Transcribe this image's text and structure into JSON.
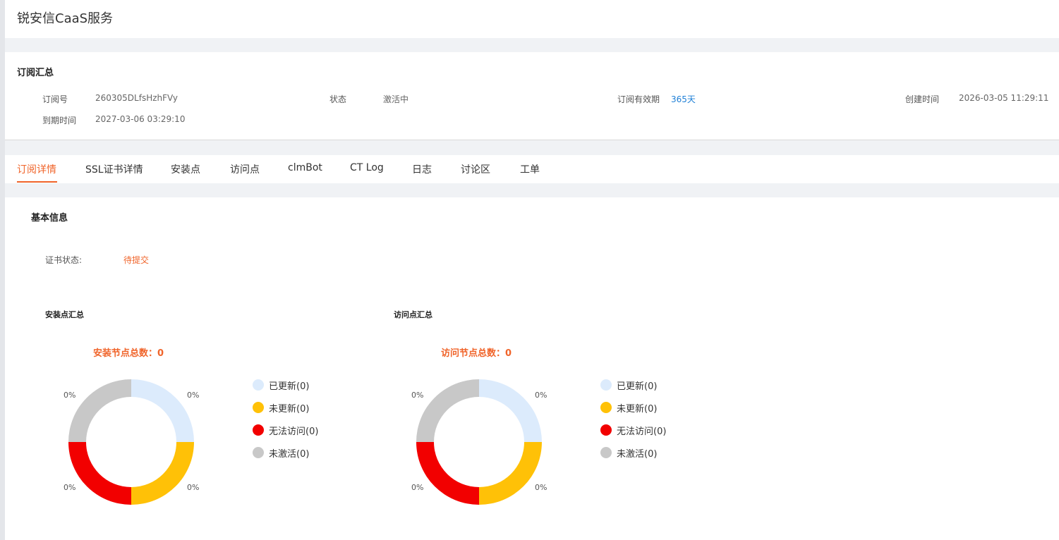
{
  "app": {
    "title": "锐安信CaaS服务"
  },
  "summary": {
    "title": "订阅汇总",
    "fields": [
      {
        "label": "订阅号",
        "value": "260305DLfsHzhFVy"
      },
      {
        "label": "状态",
        "value": "激活中"
      },
      {
        "label": "订阅有效期",
        "value": "365天"
      },
      {
        "label": "创建时间",
        "value": "2026-03-05 11:29:11"
      },
      {
        "label": "到期时间",
        "value": "2027-03-06 03:29:10"
      }
    ]
  },
  "tabs": [
    {
      "label": "订阅详情",
      "active": true
    },
    {
      "label": "SSL证书详情",
      "active": false
    },
    {
      "label": "安装点",
      "active": false
    },
    {
      "label": "访问点",
      "active": false
    },
    {
      "label": "clmBot",
      "active": false
    },
    {
      "label": "CT Log",
      "active": false
    },
    {
      "label": "日志",
      "active": false
    },
    {
      "label": "讨论区",
      "active": false
    },
    {
      "label": "工单",
      "active": false
    }
  ],
  "basic_info": {
    "title": "基本信息",
    "cert_status_label": "证书状态:",
    "cert_status_value": "待提交"
  },
  "panels": [
    {
      "title": "安装点汇总",
      "total_label": "安装节点总数：0",
      "segments": [
        {
          "label": "已更新(0)",
          "pct": "0%",
          "color": "#dcebfc"
        },
        {
          "label": "未更新(0)",
          "pct": "0%",
          "color": "#ffc107"
        },
        {
          "label": "无法访问(0)",
          "pct": "0%",
          "color": "#f20000"
        },
        {
          "label": "未激活(0)",
          "pct": "0%",
          "color": "#c8c8c8"
        }
      ]
    },
    {
      "title": "访问点汇总",
      "total_label": "访问节点总数：0",
      "segments": [
        {
          "label": "已更新(0)",
          "pct": "0%",
          "color": "#dcebfc"
        },
        {
          "label": "未更新(0)",
          "pct": "0%",
          "color": "#ffc107"
        },
        {
          "label": "无法访问(0)",
          "pct": "0%",
          "color": "#f20000"
        },
        {
          "label": "未激活(0)",
          "pct": "0%",
          "color": "#c8c8c8"
        }
      ]
    }
  ],
  "colors": {
    "accent": "#f0642a",
    "link": "#1e7fd6"
  }
}
